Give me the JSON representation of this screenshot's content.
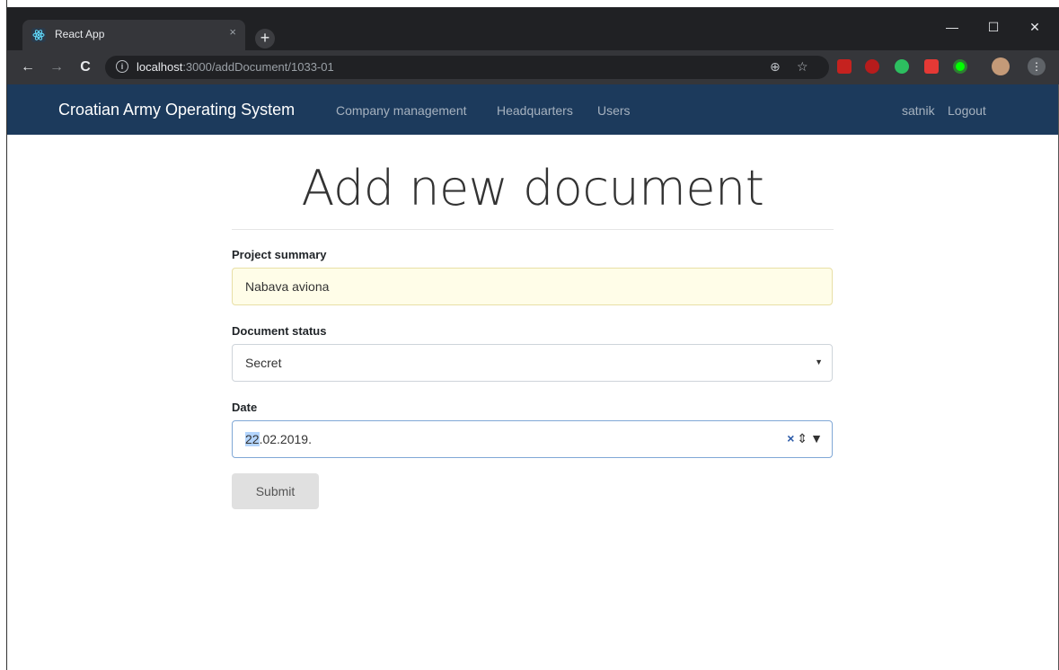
{
  "browser": {
    "tab_title": "React App",
    "tab_close": "×",
    "new_tab": "+",
    "url_host": "localhost",
    "url_path": ":3000/addDocument/1033-01",
    "info": "i",
    "window_controls": [
      "—",
      "☐",
      "✕"
    ],
    "nav": {
      "back": "←",
      "forward": "→",
      "reload": "C"
    },
    "icons": [
      "zoom-icon",
      "star-icon",
      "gmail-icon",
      "ublock-icon",
      "evernote-icon",
      "extension-icon",
      "target-icon",
      "profile-avatar",
      "menu-icon"
    ],
    "colors": {
      "frame": "#202124",
      "toolbar": "#35363a"
    }
  },
  "navbar": {
    "brand": "Croatian Army Operating System",
    "links": [
      "Company management",
      "Headquarters",
      "Users"
    ],
    "user": "satnik",
    "logout": "Logout",
    "color": "#1c3a5c"
  },
  "form": {
    "title": "Add new document",
    "project_summary": {
      "label": "Project summary",
      "value": "Nabava aviona"
    },
    "document_status": {
      "label": "Document status",
      "value": "Secret"
    },
    "date": {
      "label": "Date",
      "value_day": "22",
      "value_rest": ".02.2019."
    },
    "submit": "Submit"
  }
}
